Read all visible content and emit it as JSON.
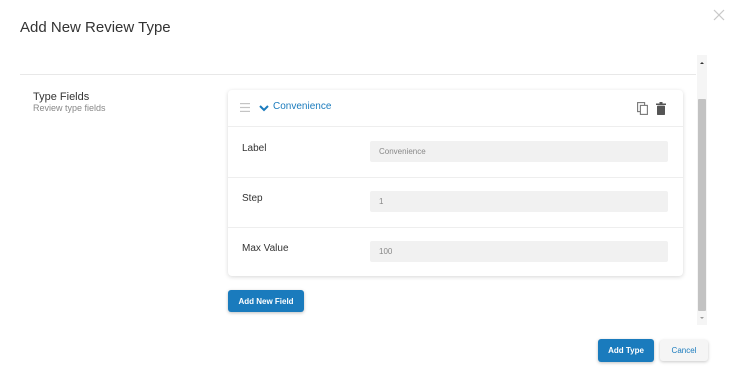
{
  "dialog": {
    "title": "Add New Review Type",
    "close_icon": "close-icon"
  },
  "section": {
    "title": "Type Fields",
    "subtitle": "Review type fields"
  },
  "field_card": {
    "title": "Convenience",
    "icons": [
      "drag-handle-icon",
      "chevron-down-icon",
      "copy-icon",
      "trash-icon"
    ],
    "rows": [
      {
        "label": "Label",
        "value": "Convenience"
      },
      {
        "label": "Step",
        "value": "1"
      },
      {
        "label": "Max Value",
        "value": "100"
      }
    ]
  },
  "buttons": {
    "add_field": "Add New Field",
    "add_type": "Add Type",
    "cancel": "Cancel"
  },
  "colors": {
    "accent": "#1a7bbd",
    "input_bg": "#f1f1f1",
    "scroll_thumb": "#c2c2c2"
  }
}
